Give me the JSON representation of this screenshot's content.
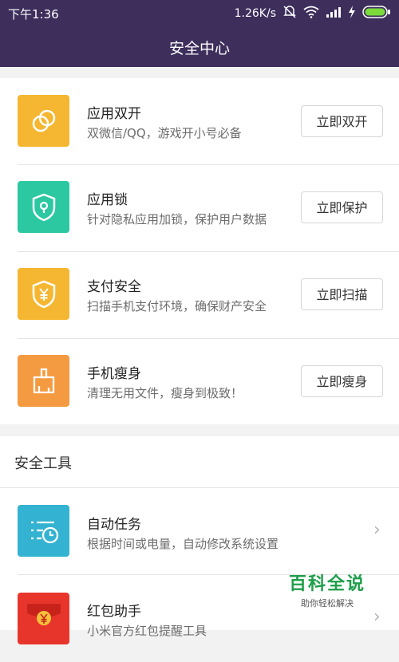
{
  "status_bar": {
    "time": "下午1:36",
    "speed": "1.26K/s"
  },
  "header": {
    "title": "安全中心"
  },
  "features": [
    {
      "title": "应用双开",
      "desc": "双微信/QQ，游戏开小号必备",
      "button": "立即双开",
      "icon": "dual-circles-icon",
      "color": "#f5b731"
    },
    {
      "title": "应用锁",
      "desc": "针对隐私应用加锁，保护用户数据",
      "button": "立即保护",
      "icon": "shield-lock-icon",
      "color": "#2bc8a1"
    },
    {
      "title": "支付安全",
      "desc": "扫描手机支付环境，确保财产安全",
      "button": "立即扫描",
      "icon": "shield-yen-icon",
      "color": "#f5b731"
    },
    {
      "title": "手机瘦身",
      "desc": "清理无用文件，瘦身到极致！",
      "button": "立即瘦身",
      "icon": "broom-icon",
      "color": "#f49a40"
    }
  ],
  "tools_section": {
    "title": "安全工具"
  },
  "tools": [
    {
      "title": "自动任务",
      "desc": "根据时间或电量，自动修改系统设置",
      "icon": "task-clock-icon",
      "color": "#33b3d1"
    },
    {
      "title": "红包助手",
      "desc": "小米官方红包提醒工具",
      "icon": "red-packet-icon",
      "color": "#e8352b"
    }
  ],
  "watermark": {
    "title": "百科全说",
    "subtitle": "助你轻松解决"
  }
}
